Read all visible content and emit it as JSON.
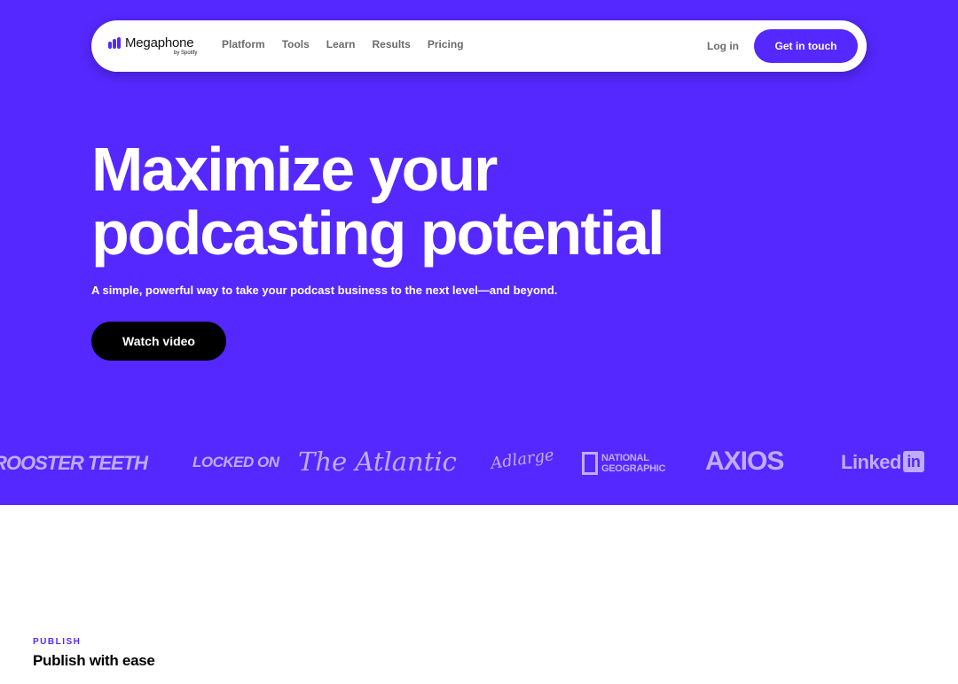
{
  "colors": {
    "brand": "#5528ff",
    "cta_dark": "#000000",
    "surface": "#ffffff"
  },
  "nav": {
    "logo_word": "Megaphone",
    "logo_sub": "by Spotify",
    "links": [
      "Platform",
      "Tools",
      "Learn",
      "Results",
      "Pricing"
    ],
    "login": "Log in",
    "cta": "Get in touch"
  },
  "hero": {
    "headline_line1": "Maximize your",
    "headline_line2": "podcasting potential",
    "subline": "A simple, powerful way to take your podcast business to the next level—and beyond.",
    "button": "Watch video"
  },
  "partners": {
    "rooster_teeth": "ROOSTER TEETH",
    "locked_on": "LOCKED ON",
    "atlantic": "The Atlantic",
    "adlarge": "Adlarge",
    "natgeo_1": "NATIONAL",
    "natgeo_2": "GEOGRAPHIC",
    "axios": "AXIOS",
    "linkedin": "Linked",
    "linkedin_box": "in"
  },
  "section": {
    "label": "PUBLISH",
    "title": "Publish with ease"
  }
}
